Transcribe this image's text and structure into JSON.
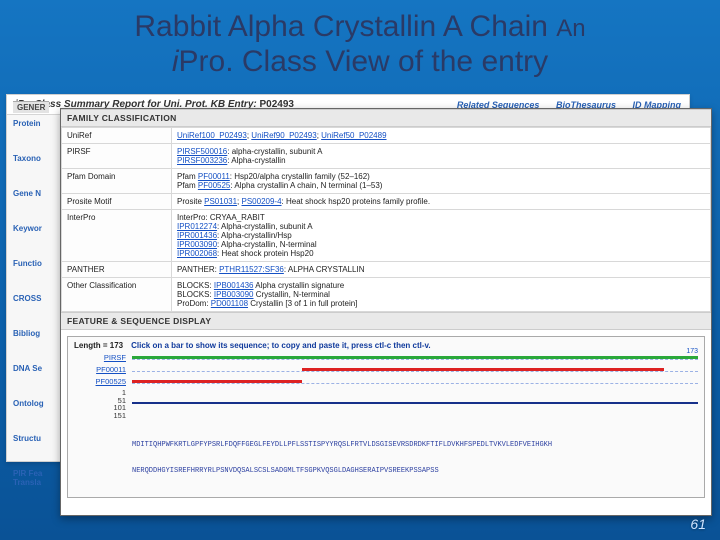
{
  "title_main": "Rabbit Alpha Crystallin A Chain",
  "title_an": "An",
  "title_i": "i",
  "title_rest": "Pro. Class View of the entry",
  "report": {
    "prefix": "iProClass Summary Report for Uni. Prot. KB Entry:",
    "acc": "P02493",
    "links": {
      "rel": "Related Sequences",
      "bio": "BioThesaurus",
      "map": "ID Mapping"
    }
  },
  "sidebar": {
    "gener": "GENER",
    "items": [
      "Protein",
      "Taxono",
      "Gene N",
      "Keywor",
      "Functio",
      "CROSS",
      "Bibliog",
      "DNA Se",
      "Ontolog",
      "Structu",
      "PIR Fea\nTransla"
    ]
  },
  "sections": {
    "family": "FAMILY CLASSIFICATION",
    "feature": "FEATURE & SEQUENCE DISPLAY"
  },
  "rows": {
    "uniref": {
      "k": "UniRef",
      "v_links": [
        "UniRef100_P02493",
        "UniRef90_P02493",
        "UniRef50_P02489"
      ]
    },
    "pirsf": {
      "k": "PIRSF",
      "v": [
        {
          "l": "PIRSF500016",
          "t": ": alpha-crystallin, subunit A"
        },
        {
          "l": "PIRSF003236",
          "t": ": Alpha-crystallin"
        }
      ]
    },
    "pfam": {
      "k": "Pfam Domain",
      "v": [
        {
          "p": "Pfam ",
          "l": "PF00011",
          "t": ": Hsp20/alpha crystallin family (52–162)"
        },
        {
          "p": "Pfam ",
          "l": "PF00525",
          "t": ": Alpha crystallin A chain, N terminal (1–53)"
        }
      ]
    },
    "prosite": {
      "k": "Prosite Motif",
      "v": [
        {
          "p": "Prosite ",
          "l": "PS01031",
          "t": "; "
        },
        {
          "l2": "PS00209-4",
          "t2": ": Heat shock hsp20 proteins family profile."
        }
      ]
    },
    "interpro": {
      "k": "InterPro",
      "pre": "InterPro: CRYAA_RABIT",
      "v": [
        {
          "l": "IPR012274",
          "t": ": Alpha-crystallin, subunit A"
        },
        {
          "l": "IPR001436",
          "t": ": Alpha-crystallin/Hsp"
        },
        {
          "l": "IPR003090",
          "t": ": Alpha-crystallin, N-terminal"
        },
        {
          "l": "IPR002068",
          "t": ": Heat shock protein Hsp20"
        }
      ]
    },
    "panth": {
      "k": "PANTHER",
      "v": {
        "p": "PANTHER: ",
        "l": "PTHR11527:SF36",
        "t": ": ALPHA CRYSTALLIN"
      }
    },
    "other": {
      "k": "Other Classification",
      "v": [
        {
          "p": "BLOCKS: ",
          "l": "IPB001436",
          "t": " Alpha crystallin signature"
        },
        {
          "p": "BLOCKS: ",
          "l": "IPB003090",
          "t": " Crystallin, N-terminal"
        },
        {
          "p": "ProDom: ",
          "l": "PD001108",
          "t": " Crystallin [3 of 1 in full protein]"
        }
      ]
    }
  },
  "feature": {
    "len": "Length = 173",
    "hint": "Click on a bar to show its sequence; to copy and paste it, press ctl-c then ctl-v.",
    "end": "173",
    "tracks": [
      "PIRSF",
      "PF00011",
      "PF00525"
    ],
    "nums": [
      "1\n51\n101\n151"
    ],
    "seq1": "MDITIQHPWFKRTLGPFYPSRLFDQFFGEGLFEYDLLPFLSSTISPYYRQSLFRTVLDSGISEVRSDRDKFTIFLDVKHFSPEDLTVKVLEDFVEIHGKH",
    "seq2": "NERQDDHGYISREFHRRYRLPSNVDQSALSCSLSADGMLTFSGPKVQSGLDAGHSERAIPVSREEKPSSAPSS"
  },
  "page": "61"
}
